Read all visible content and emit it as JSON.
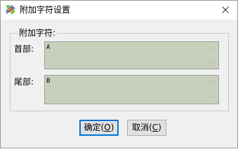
{
  "window": {
    "title": "附加字符设置",
    "icon": "app-logo-icon",
    "close_icon": "close-icon"
  },
  "group": {
    "legend": "附加字符:"
  },
  "fields": {
    "header": {
      "label": "首部:",
      "value": "A"
    },
    "footer": {
      "label": "尾部:",
      "value": "B"
    }
  },
  "buttons": {
    "ok": {
      "text": "确定(",
      "accel": "O",
      "close": ")"
    },
    "cancel": {
      "text": "取消(",
      "accel": "C",
      "close": ")"
    }
  },
  "colors": {
    "field_background": "#c7d0bb",
    "default_button_border": "#0078d7"
  }
}
